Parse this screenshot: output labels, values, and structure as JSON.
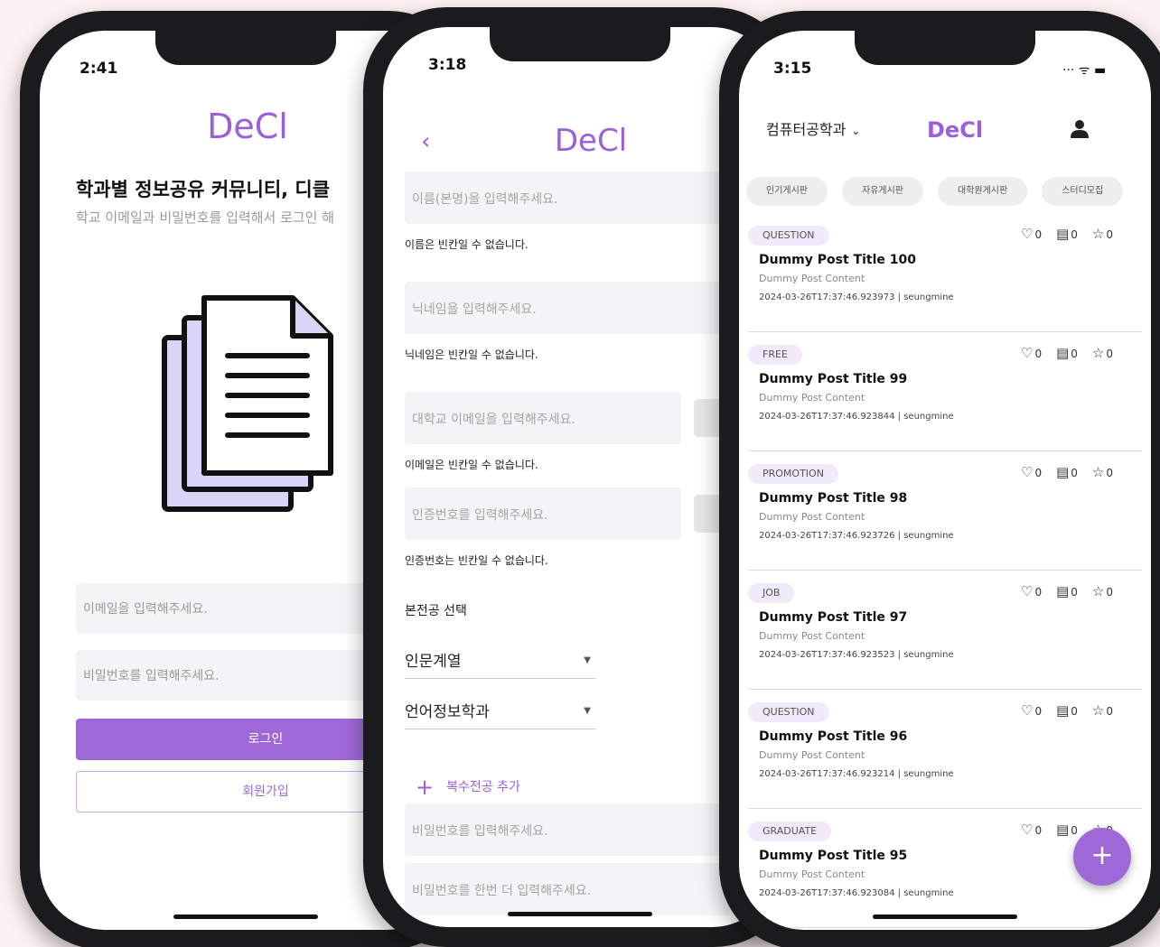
{
  "phone1": {
    "time": "2:41",
    "brand": "DeCl",
    "headline": "학과별 정보공유 커뮤니티, 디클",
    "subline": "학교 이메일과 비밀번호를 입력해서 로그인 해",
    "email_placeholder": "이메일을 입력해주세요.",
    "password_placeholder": "비밀번호를 입력해주세요.",
    "login_label": "로그인",
    "signup_label": "회원가입"
  },
  "phone2": {
    "time": "3:18",
    "brand": "DeCl",
    "back": "‹",
    "name_placeholder": "이름(본명)을 입력해주세요.",
    "name_error": "이름은 빈칸일 수 없습니다.",
    "nickname_placeholder": "닉네임을 입력해주세요.",
    "nickname_error": "닉네임은 빈칸일 수 없습니다.",
    "email_placeholder": "대학교 이메일을 입력해주세요.",
    "email_error": "이메일은 빈칸일 수 없습니다.",
    "code_placeholder": "인증번호를 입력해주세요.",
    "code_error": "인증번호는 빈칸일 수 없습니다.",
    "major_label": "본전공 선택",
    "college_value": "인문계열",
    "dept_value": "언어정보학과",
    "add_major_label": "복수전공 추가",
    "password_placeholder": "비밀번호를 입력해주세요.",
    "password_confirm_placeholder": "비밀번호를 한번 더 입력해주세요."
  },
  "phone3": {
    "time": "3:15",
    "status_icons": "···  ᯤ ▬",
    "department": "컴퓨터공학과",
    "brand": "DeCl",
    "categories": [
      "인기게시판",
      "자유게시판",
      "대학원게시판",
      "스터디모집"
    ],
    "posts": [
      {
        "tag": "QUESTION",
        "title": "Dummy Post Title 100",
        "content": "Dummy Post Content",
        "meta": "2024-03-26T17:37:46.923973 | seungmine",
        "likes": "0",
        "comments": "0",
        "stars": "0"
      },
      {
        "tag": "FREE",
        "title": "Dummy Post Title 99",
        "content": "Dummy Post Content",
        "meta": "2024-03-26T17:37:46.923844 | seungmine",
        "likes": "0",
        "comments": "0",
        "stars": "0"
      },
      {
        "tag": "PROMOTION",
        "title": "Dummy Post Title 98",
        "content": "Dummy Post Content",
        "meta": "2024-03-26T17:37:46.923726 | seungmine",
        "likes": "0",
        "comments": "0",
        "stars": "0"
      },
      {
        "tag": "JOB",
        "title": "Dummy Post Title 97",
        "content": "Dummy Post Content",
        "meta": "2024-03-26T17:37:46.923523 | seungmine",
        "likes": "0",
        "comments": "0",
        "stars": "0"
      },
      {
        "tag": "QUESTION",
        "title": "Dummy Post Title 96",
        "content": "Dummy Post Content",
        "meta": "2024-03-26T17:37:46.923214 | seungmine",
        "likes": "0",
        "comments": "0",
        "stars": "0"
      },
      {
        "tag": "GRADUATE",
        "title": "Dummy Post Title 95",
        "content": "Dummy Post Content",
        "meta": "2024-03-26T17:37:46.923084 | seungmine",
        "likes": "0",
        "comments": "0",
        "stars": "0"
      }
    ],
    "fab": "+"
  },
  "colors": {
    "accent": "#9f68d8",
    "background": "#fdf1f1"
  }
}
